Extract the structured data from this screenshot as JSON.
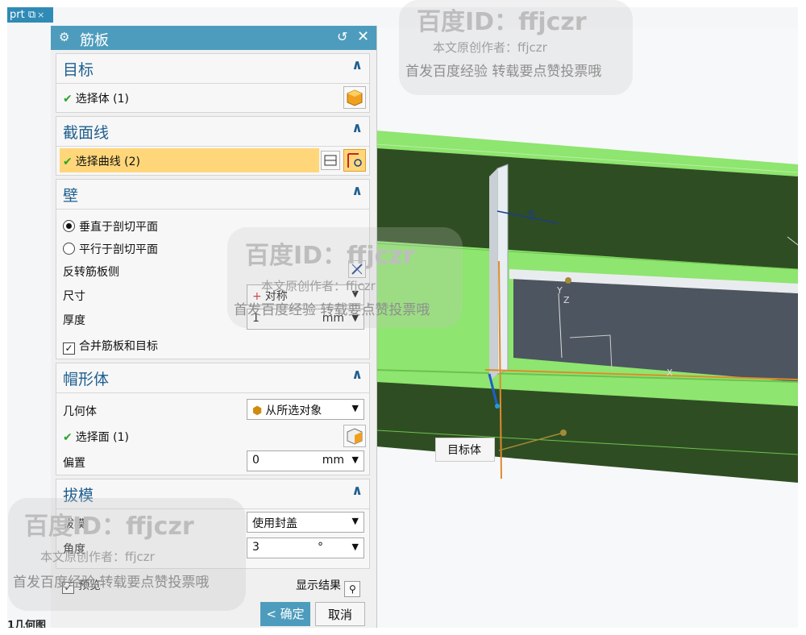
{
  "tab": {
    "label": "prt",
    "close": "×"
  },
  "dialog": {
    "title": "筋板",
    "groups": {
      "target": {
        "header": "目标",
        "select_body": "选择体 (1)"
      },
      "section": {
        "header": "截面线",
        "select_curve": "选择曲线 (2)"
      },
      "wall": {
        "header": "壁",
        "radio_perp": "垂直于剖切平面",
        "radio_parallel": "平行于剖切平面",
        "reverse_side": "反转筋板侧",
        "size_label": "尺寸",
        "size_value": "对称",
        "thickness_label": "厚度",
        "thickness_value": "1",
        "thickness_unit": "mm",
        "merge_label": "合并筋板和目标"
      },
      "cap": {
        "header": "帽形体",
        "geometry_label": "几何体",
        "geometry_value": "从所选对象",
        "select_face": "选择面 (1)",
        "offset_label": "偏置",
        "offset_value": "0",
        "offset_unit": "mm"
      },
      "draft": {
        "header": "拔模",
        "draft_label": "拔模",
        "draft_value": "使用封盖",
        "angle_label": "角度",
        "angle_value": "3",
        "angle_unit": "°"
      }
    },
    "preview_label": "预览",
    "show_result_label": "显示结果",
    "ok_label": "< 确定 >",
    "cancel_label": "取消"
  },
  "viewport": {
    "dimension_label": "5",
    "axis_y": "Y",
    "axis_z": "Z",
    "axis_x": "X",
    "target_tag": "目标体"
  },
  "bottom_left_text": "1几何图",
  "watermark": {
    "line1": "百度ID：ffjczr",
    "line2": "本文原创作者：ffjczr",
    "line3": "首发百度经验 转载要点赞投票哦"
  },
  "colors": {
    "title_bar": "#4e9cbd",
    "highlight": "#ffd77a",
    "accent": "#1f5f8f",
    "green_model": "#8ee56f",
    "dark_face": "#2f4d22"
  }
}
